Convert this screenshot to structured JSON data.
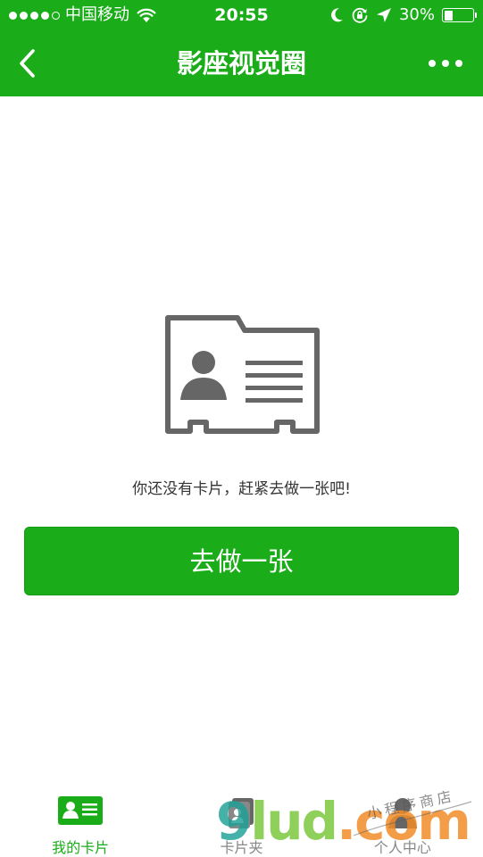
{
  "status_bar": {
    "carrier": "中国移动",
    "time": "20:55",
    "battery_percent": "30%",
    "battery_level": 0.3,
    "signal_bars_filled": 4,
    "signal_bars_total": 5
  },
  "nav": {
    "title": "影座视觉圈",
    "back_icon": "chevron-left-icon",
    "more_icon": "more-dots-icon"
  },
  "empty_state": {
    "icon": "id-card-icon",
    "message": "你还没有卡片，赶紧去做一张吧!",
    "button_label": "去做一张"
  },
  "tabs": [
    {
      "label": "我的卡片",
      "icon": "id-card-icon",
      "active": true
    },
    {
      "label": "卡片夹",
      "icon": "card-stack-icon",
      "active": false
    },
    {
      "label": "个人中心",
      "icon": "user-icon",
      "active": false
    }
  ],
  "watermark": {
    "main_1": "9",
    "main_2": "lud",
    "main_3": ".com",
    "sub": "小程序商店"
  },
  "colors": {
    "brand_green": "#1aad19",
    "text_dark": "#353535",
    "tab_inactive": "#888888",
    "icon_gray": "#666666"
  }
}
